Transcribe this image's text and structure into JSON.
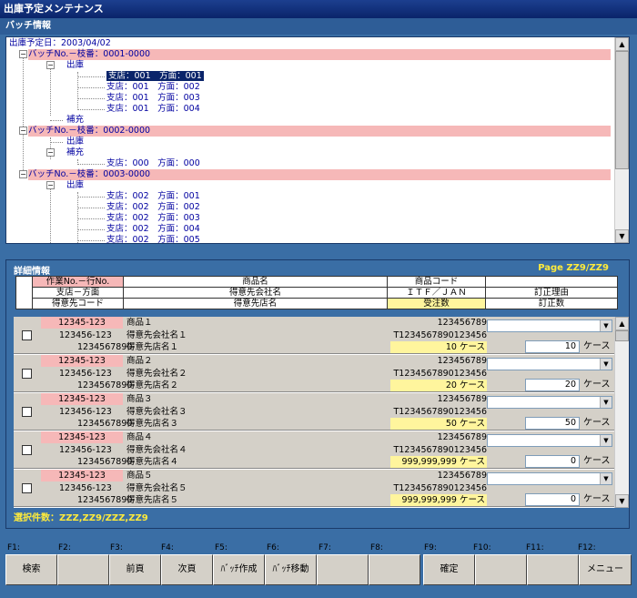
{
  "window": {
    "title": "出庫予定メンテナンス"
  },
  "batch_section": {
    "label": "バッチ情報"
  },
  "tree": {
    "root": "出庫予定日：2003/04/02",
    "batch1": "バッチNo.－枝番：0001-0000",
    "b1_out": "出庫",
    "b1_items": [
      "支店：001　方面：001",
      "支店：001　方面：002",
      "支店：001　方面：003",
      "支店：001　方面：004"
    ],
    "b1_refill": "補充",
    "batch2": "バッチNo.－枝番：0002-0000",
    "b2_out": "出庫",
    "b2_refill": "補充",
    "b2_items": [
      "支店：000　方面：000"
    ],
    "batch3": "バッチNo.－枝番：0003-0000",
    "b3_out": "出庫",
    "b3_items": [
      "支店：002　方面：001",
      "支店：002　方面：002",
      "支店：002　方面：003",
      "支店：002　方面：004",
      "支店：002　方面：005"
    ]
  },
  "detail": {
    "title": "詳細情報",
    "page": "Page ZZ9/ZZ9",
    "headers": {
      "r1": [
        "作業No.－行No.",
        "商品名",
        "商品コード",
        ""
      ],
      "r2": [
        "支店－方面",
        "得意先会社名",
        "ＩＴＦ／ＪＡＮ",
        "訂正理由"
      ],
      "r3": [
        "得意先コード",
        "得意先店名",
        "受注数",
        "訂正数"
      ]
    },
    "rows": [
      {
        "work": "12345-123",
        "branch": "123456-123",
        "customer_code": "1234567890",
        "product": "商品１",
        "company": "得意先会社名１",
        "store": "得意先店名１",
        "code": "123456789",
        "itf": "T1234567890123456",
        "qty": "10",
        "unit": "ケース",
        "corr": "10",
        "corr_unit": "ケース"
      },
      {
        "work": "12345-123",
        "branch": "123456-123",
        "customer_code": "1234567890",
        "product": "商品２",
        "company": "得意先会社名２",
        "store": "得意先店名２",
        "code": "123456789",
        "itf": "T1234567890123456",
        "qty": "20",
        "unit": "ケース",
        "corr": "20",
        "corr_unit": "ケース"
      },
      {
        "work": "12345-123",
        "branch": "123456-123",
        "customer_code": "1234567890",
        "product": "商品３",
        "company": "得意先会社名３",
        "store": "得意先店名３",
        "code": "123456789",
        "itf": "T1234567890123456",
        "qty": "50",
        "unit": "ケース",
        "corr": "50",
        "corr_unit": "ケース"
      },
      {
        "work": "12345-123",
        "branch": "123456-123",
        "customer_code": "1234567890",
        "product": "商品４",
        "company": "得意先会社名４",
        "store": "得意先店名４",
        "code": "123456789",
        "itf": "T1234567890123456",
        "qty": "999,999,999",
        "unit": "ケース",
        "corr": "0",
        "corr_unit": "ケース"
      },
      {
        "work": "12345-123",
        "branch": "123456-123",
        "customer_code": "1234567890",
        "product": "商品５",
        "company": "得意先会社名５",
        "store": "得意先店名５",
        "code": "123456789",
        "itf": "T1234567890123456",
        "qty": "999,999,999",
        "unit": "ケース",
        "corr": "0",
        "corr_unit": "ケース"
      }
    ],
    "selected_count": "選択件数：ZZZ,ZZ9/ZZZ,ZZ9"
  },
  "fkeys": {
    "labels": [
      "F1:",
      "F2:",
      "F3:",
      "F4:",
      "F5:",
      "F6:",
      "F7:",
      "F8:",
      "F9:",
      "F10:",
      "F11:",
      "F12:"
    ],
    "buttons": [
      "検索",
      "",
      "前頁",
      "次頁",
      "ﾊﾞｯﾁ作成",
      "ﾊﾞｯﾁ移動",
      "",
      "",
      "確定",
      "",
      "",
      "メニュー"
    ]
  }
}
